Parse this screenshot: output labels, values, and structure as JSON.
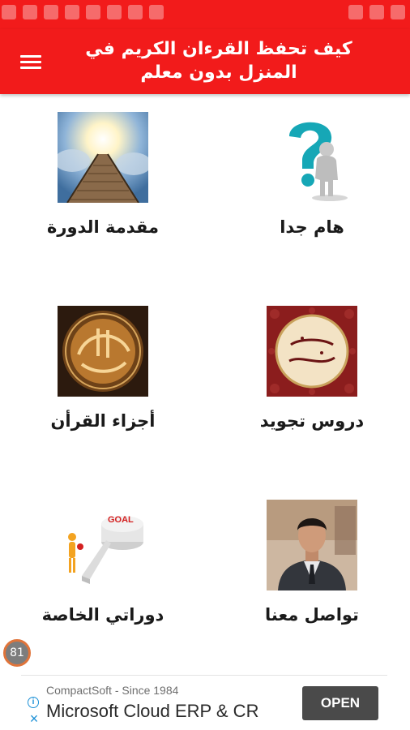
{
  "app_bar": {
    "title": "كيف تحفظ القرءان الكريم في المنزل بدون معلم",
    "menu_icon": "hamburger-menu-icon",
    "background_color": "#f21b1b"
  },
  "grid": [
    {
      "label": "هام جدا",
      "image": "question-figure-icon"
    },
    {
      "label": "مقدمة الدورة",
      "image": "stairway-to-heaven-image"
    },
    {
      "label": "دروس تجويد",
      "image": "tajweed-calligraphy-image"
    },
    {
      "label": "أجزاء القرأن",
      "image": "quran-calligraphy-image"
    },
    {
      "label": "تواصل معنا",
      "image": "man-portrait-image"
    },
    {
      "label": "دوراتي الخاصة",
      "image": "goal-figure-image"
    }
  ],
  "badge": {
    "count": "81"
  },
  "ad": {
    "subtitle": "CompactSoft - Since 1984",
    "title": "Microsoft Cloud ERP & CR",
    "button": "OPEN",
    "info_icon": "info-icon",
    "close_icon": "close-icon"
  }
}
